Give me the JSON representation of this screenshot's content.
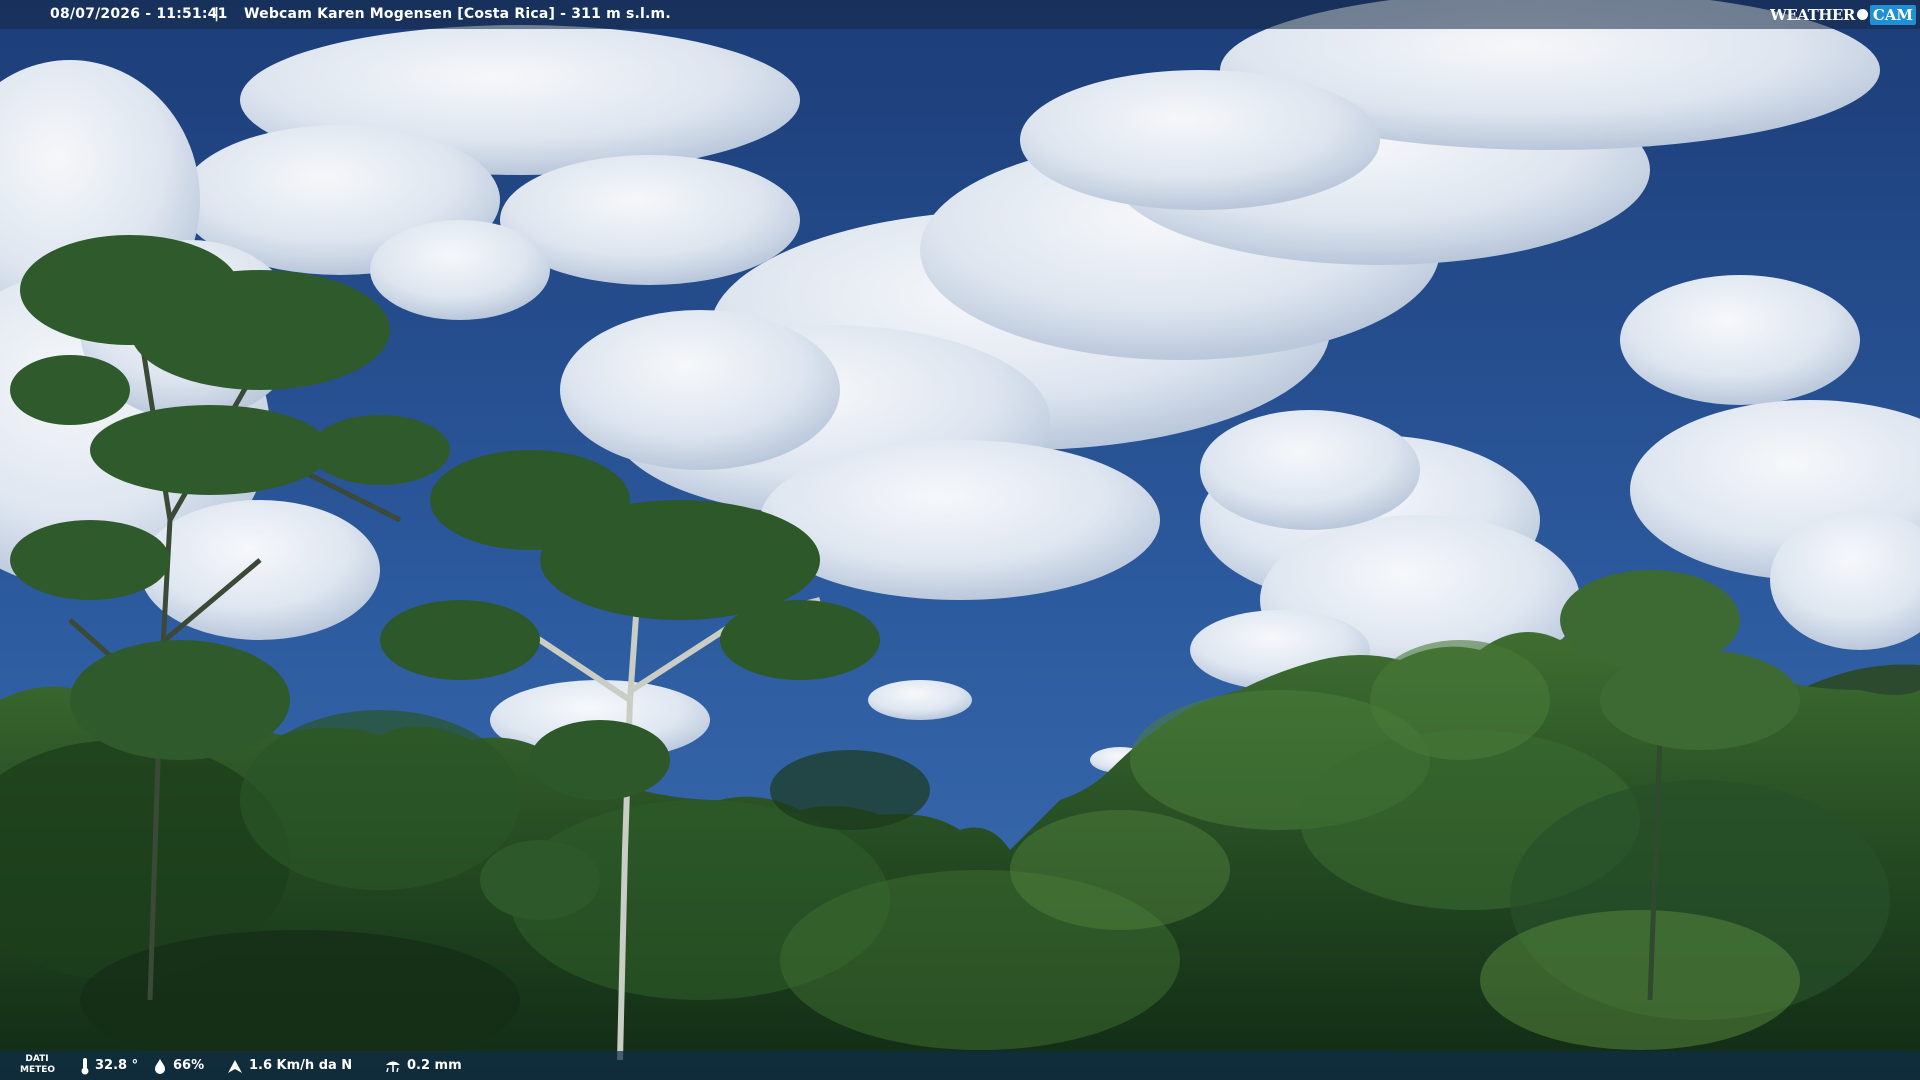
{
  "overlay": {
    "timestamp": "08/07/2026 - 11:51:41",
    "separator": "|",
    "title": "Webcam Karen Mogensen [Costa Rica]  - 311 m s.l.m."
  },
  "brand": {
    "word": "WEATHER",
    "badge": "CAM"
  },
  "weather": {
    "label_line1": "DATI",
    "label_line2": "METEO",
    "temperature": "32.8 °",
    "humidity": "66%",
    "wind": "1.6 Km/h da N",
    "rain": "0.2 mm"
  },
  "icons": {
    "temperature": "thermometer-icon",
    "humidity": "drop-icon",
    "wind": "wind-icon",
    "rain": "rain-icon"
  },
  "colors": {
    "sky_top": "#1c3d78",
    "sky_bottom": "#3a6cb0",
    "forest_dark": "#14301a",
    "forest_mid": "#2d5a2b",
    "forest_light": "#4f7e3c",
    "brand_badge": "#1f8fd6"
  }
}
